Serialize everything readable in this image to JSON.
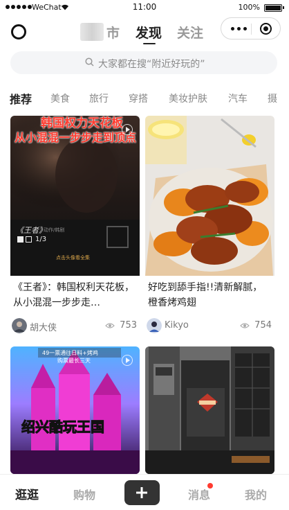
{
  "status_bar": {
    "carrier": "WeChat",
    "time": "11:00",
    "battery": "100%"
  },
  "header": {
    "tabs": [
      {
        "label": "市"
      },
      {
        "label": "发现"
      },
      {
        "label": "关注"
      }
    ]
  },
  "search": {
    "placeholder": "大家都在搜“附近好玩的”"
  },
  "categories": [
    "推荐",
    "美食",
    "旅行",
    "穿搭",
    "美妆护肤",
    "汽车",
    "摄"
  ],
  "feed": [
    {
      "title": "《王者》：韩国权利天花板，从小混混一步步走…",
      "author": "胡大侠",
      "views": "753",
      "cover": {
        "line1": "韩国权力天花板",
        "line2": "从小混混一步步走到顶点",
        "tag": "《王者》",
        "tag_sub": "动作/韩剧",
        "episode": "1/3",
        "hint": "点击头像看全集"
      }
    },
    {
      "title": "好吃到舔手指!!清新解腻，橙香烤鸡翅",
      "author": "Kikyo",
      "views": "754"
    },
    {
      "title": "",
      "author": "",
      "views": "",
      "cover": {
        "banner": "49一票通往日料+烤鸡",
        "banner2": "购票最长三天",
        "headline": "绍兴酷玩王国"
      }
    },
    {
      "title": "",
      "author": "",
      "views": ""
    }
  ],
  "bottom_nav": [
    {
      "label": "逛逛"
    },
    {
      "label": "购物"
    },
    {
      "label": "消息"
    },
    {
      "label": "我的"
    }
  ]
}
